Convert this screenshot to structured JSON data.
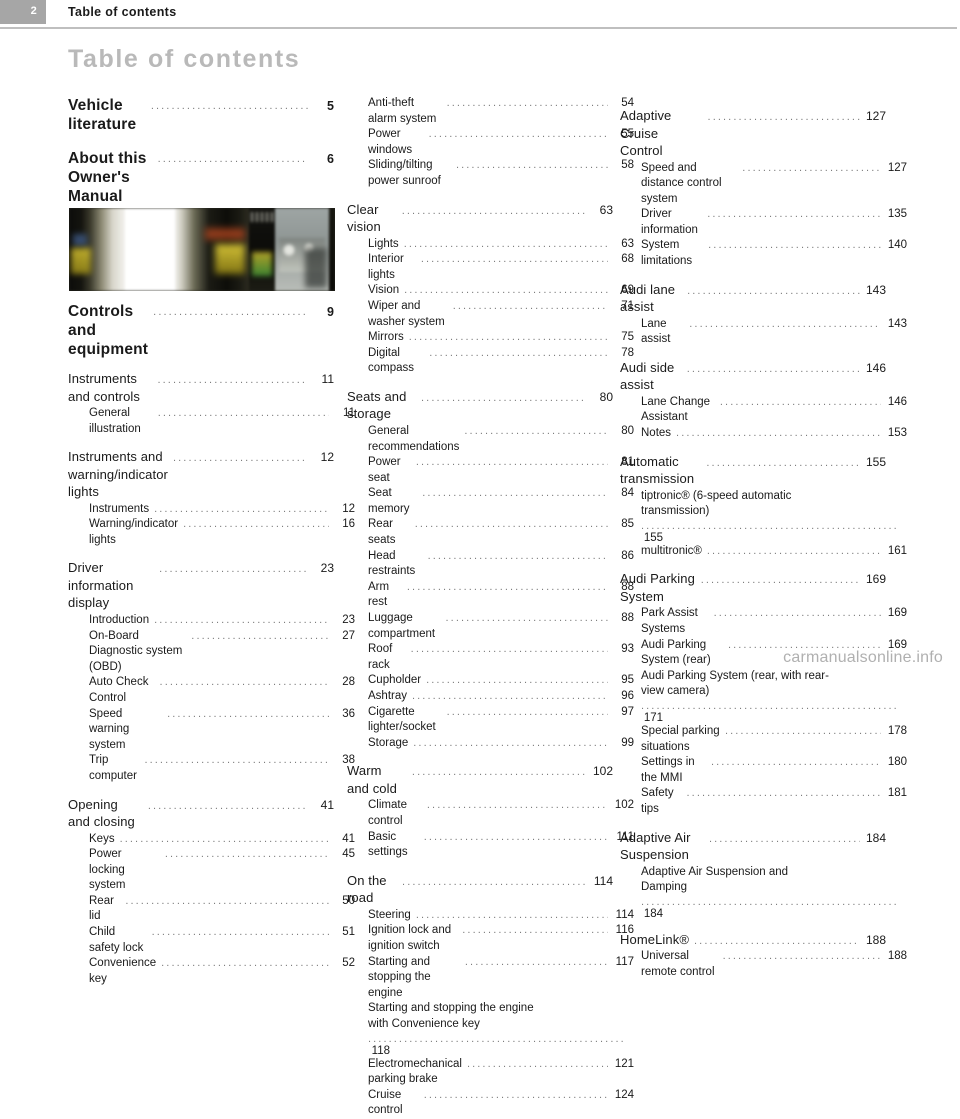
{
  "header": {
    "page_badge": "2",
    "title": "Table of contents"
  },
  "doc_title": "Table of contents",
  "leader": "..................................................",
  "watermark": "carmanualsonline.info",
  "photo": {
    "alt": "blurred photo strip of vehicle and cockpit"
  },
  "columns": [
    {
      "id": "col-1",
      "entries": [
        {
          "type": "sec",
          "label": "Vehicle literature",
          "page": "5"
        },
        {
          "type": "sec",
          "label": "About this Owner's\nManual",
          "page": "6"
        },
        {
          "type": "sec",
          "label": "Controls and\nequipment",
          "page": "9"
        },
        {
          "type": "chap",
          "label": "Instruments and controls",
          "page": "11"
        },
        {
          "type": "sub",
          "label": "General illustration",
          "page": "11"
        },
        {
          "type": "chap",
          "label": "Instruments and\nwarning/indicator lights",
          "page": "12"
        },
        {
          "type": "sub",
          "label": "Instruments",
          "page": "12"
        },
        {
          "type": "sub",
          "label": "Warning/indicator lights",
          "page": "16"
        },
        {
          "type": "chap",
          "label": "Driver information display",
          "page": "23"
        },
        {
          "type": "sub",
          "label": "Introduction",
          "page": "23"
        },
        {
          "type": "sub",
          "label": "On-Board Diagnostic system (OBD)",
          "page": "27"
        },
        {
          "type": "sub",
          "label": "Auto Check Control",
          "page": "28"
        },
        {
          "type": "sub",
          "label": "Speed warning system",
          "page": "36"
        },
        {
          "type": "sub",
          "label": "Trip computer",
          "page": "38"
        },
        {
          "type": "chap",
          "label": "Opening and closing",
          "page": "41"
        },
        {
          "type": "sub",
          "label": "Keys",
          "page": "41"
        },
        {
          "type": "sub",
          "label": "Power locking system",
          "page": "45"
        },
        {
          "type": "sub",
          "label": "Rear lid",
          "page": "50"
        },
        {
          "type": "sub",
          "label": "Child safety lock",
          "page": "51"
        },
        {
          "type": "sub",
          "label": "Convenience key",
          "page": "52"
        }
      ]
    },
    {
      "id": "col-2",
      "entries": [
        {
          "type": "sub",
          "label": "Anti-theft alarm system",
          "page": "54"
        },
        {
          "type": "sub",
          "label": "Power windows",
          "page": "55"
        },
        {
          "type": "sub",
          "label": "Sliding/tilting power sunroof",
          "page": "58"
        },
        {
          "type": "chap",
          "label": "Clear vision",
          "page": "63"
        },
        {
          "type": "sub",
          "label": "Lights",
          "page": "63"
        },
        {
          "type": "sub",
          "label": "Interior lights",
          "page": "68"
        },
        {
          "type": "sub",
          "label": "Vision",
          "page": "69"
        },
        {
          "type": "sub",
          "label": "Wiper and washer system",
          "page": "71"
        },
        {
          "type": "sub",
          "label": "Mirrors",
          "page": "75"
        },
        {
          "type": "sub",
          "label": "Digital compass",
          "page": "78"
        },
        {
          "type": "chap",
          "label": "Seats and storage",
          "page": "80"
        },
        {
          "type": "sub",
          "label": "General recommendations",
          "page": "80"
        },
        {
          "type": "sub",
          "label": "Power seat",
          "page": "81"
        },
        {
          "type": "sub",
          "label": "Seat memory",
          "page": "84"
        },
        {
          "type": "sub",
          "label": "Rear seats",
          "page": "85"
        },
        {
          "type": "sub",
          "label": "Head restraints",
          "page": "86"
        },
        {
          "type": "sub",
          "label": "Arm rest",
          "page": "88"
        },
        {
          "type": "sub",
          "label": "Luggage compartment",
          "page": "88"
        },
        {
          "type": "sub",
          "label": "Roof rack",
          "page": "93"
        },
        {
          "type": "sub",
          "label": "Cupholder",
          "page": "95"
        },
        {
          "type": "sub",
          "label": "Ashtray",
          "page": "96"
        },
        {
          "type": "sub",
          "label": "Cigarette lighter/socket",
          "page": "97"
        },
        {
          "type": "sub",
          "label": "Storage",
          "page": "99"
        },
        {
          "type": "chap",
          "label": "Warm and cold",
          "page": "102"
        },
        {
          "type": "sub",
          "label": "Climate control",
          "page": "102"
        },
        {
          "type": "sub",
          "label": "Basic settings",
          "page": "111"
        },
        {
          "type": "chap",
          "label": "On the road",
          "page": "114"
        },
        {
          "type": "sub",
          "label": "Steering",
          "page": "114"
        },
        {
          "type": "sub",
          "label": "Ignition lock and ignition switch",
          "page": "116"
        },
        {
          "type": "sub",
          "label": "Starting and stopping the engine",
          "page": "117"
        },
        {
          "type": "sub",
          "wrap": true,
          "label": "Starting and stopping the engine\nwith Convenience key",
          "page": "118"
        },
        {
          "type": "sub",
          "label": "Electromechanical parking brake",
          "page": "121"
        },
        {
          "type": "sub",
          "label": "Cruise control",
          "page": "124"
        }
      ]
    },
    {
      "id": "col-3",
      "entries": [
        {
          "type": "chap",
          "label": "Adaptive Cruise Control",
          "page": "127"
        },
        {
          "type": "sub",
          "label": "Speed and distance control system",
          "page": "127"
        },
        {
          "type": "sub",
          "label": "Driver information",
          "page": "135"
        },
        {
          "type": "sub",
          "label": "System limitations",
          "page": "140"
        },
        {
          "type": "chap",
          "label": "Audi lane assist",
          "page": "143"
        },
        {
          "type": "sub",
          "label": "Lane assist",
          "page": "143"
        },
        {
          "type": "chap",
          "label": "Audi side assist",
          "page": "146"
        },
        {
          "type": "sub",
          "label": "Lane Change Assistant",
          "page": "146"
        },
        {
          "type": "sub",
          "label": "Notes",
          "page": "153"
        },
        {
          "type": "chap",
          "label": "Automatic transmission",
          "page": "155"
        },
        {
          "type": "sub",
          "wrap": true,
          "label": "tiptronic® (6-speed automatic\ntransmission)",
          "page": "155"
        },
        {
          "type": "sub",
          "label": "multitronic®",
          "page": "161"
        },
        {
          "type": "chap",
          "label": "Audi Parking System",
          "page": "169"
        },
        {
          "type": "sub",
          "label": "Park Assist Systems",
          "page": "169"
        },
        {
          "type": "sub",
          "label": "Audi Parking System (rear)",
          "page": "169"
        },
        {
          "type": "sub",
          "wrap": true,
          "label": "Audi Parking System (rear, with rear-\nview camera)",
          "page": "171"
        },
        {
          "type": "sub",
          "label": "Special parking situations",
          "page": "178"
        },
        {
          "type": "sub",
          "label": "Settings in the MMI",
          "page": "180"
        },
        {
          "type": "sub",
          "label": "Safety tips",
          "page": "181"
        },
        {
          "type": "chap",
          "label": "Adaptive Air Suspension",
          "page": "184"
        },
        {
          "type": "sub",
          "wrap": true,
          "label": "Adaptive Air Suspension and\nDamping",
          "page": "184"
        },
        {
          "type": "chap",
          "label": "HomeLink®",
          "page": "188"
        },
        {
          "type": "sub",
          "label": "Universal remote control",
          "page": "188"
        }
      ]
    }
  ]
}
